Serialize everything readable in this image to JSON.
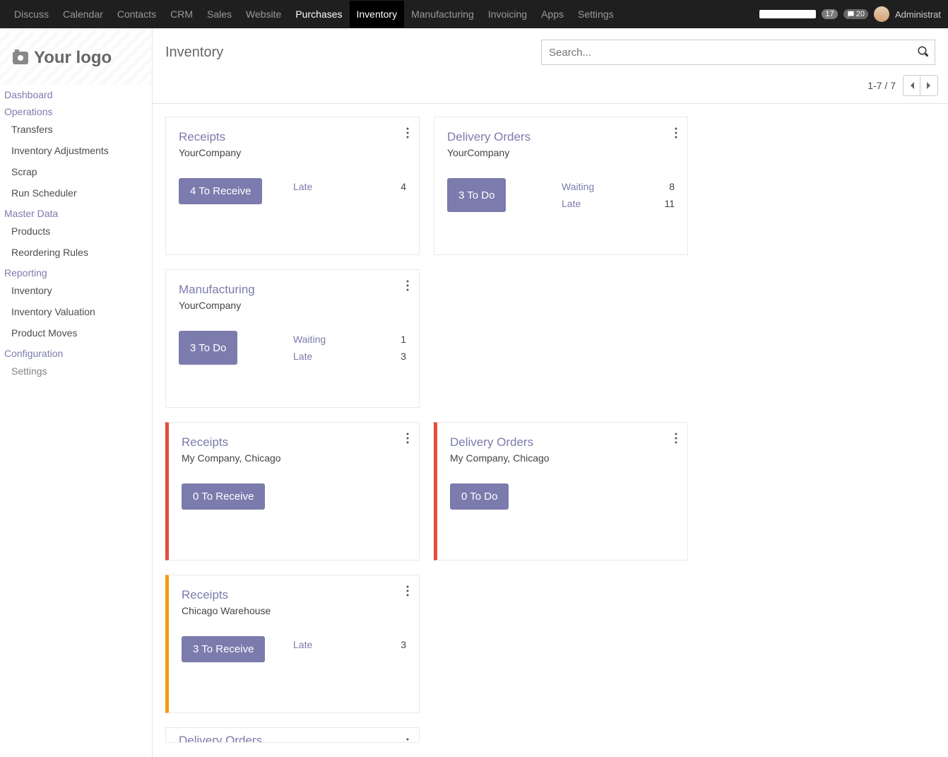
{
  "topnav": {
    "items": [
      {
        "label": "Discuss"
      },
      {
        "label": "Calendar"
      },
      {
        "label": "Contacts"
      },
      {
        "label": "CRM"
      },
      {
        "label": "Sales"
      },
      {
        "label": "Website"
      },
      {
        "label": "Purchases"
      },
      {
        "label": "Inventory"
      },
      {
        "label": "Manufacturing"
      },
      {
        "label": "Invoicing"
      },
      {
        "label": "Apps"
      },
      {
        "label": "Settings"
      }
    ],
    "badge1": "17",
    "badge2": "20",
    "user": "Administrat"
  },
  "logo_text": "Your logo",
  "sidebar": {
    "sections": [
      {
        "title": "Dashboard",
        "items": []
      },
      {
        "title": "Operations",
        "items": [
          "Transfers",
          "Inventory Adjustments",
          "Scrap",
          "Run Scheduler"
        ]
      },
      {
        "title": "Master Data",
        "items": [
          "Products",
          "Reordering Rules"
        ]
      },
      {
        "title": "Reporting",
        "items": [
          "Inventory",
          "Inventory Valuation",
          "Product Moves"
        ]
      },
      {
        "title": "Configuration",
        "items": [
          "Settings"
        ]
      }
    ]
  },
  "page_title": "Inventory",
  "search_placeholder": "Search...",
  "pager_text": "1-7 / 7",
  "cards_row1": [
    {
      "title": "Receipts",
      "sub": "YourCompany",
      "btn": "4 To Receive",
      "stats": [
        {
          "label": "Late",
          "val": "4"
        }
      ]
    },
    {
      "title": "Delivery Orders",
      "sub": "YourCompany",
      "btn": "3 To Do",
      "stats": [
        {
          "label": "Waiting",
          "val": "8"
        },
        {
          "label": "Late",
          "val": "11"
        }
      ]
    },
    {
      "title": "Manufacturing",
      "sub": "YourCompany",
      "btn": "3 To Do",
      "stats": [
        {
          "label": "Waiting",
          "val": "1"
        },
        {
          "label": "Late",
          "val": "3"
        }
      ]
    }
  ],
  "cards_row2": [
    {
      "title": "Receipts",
      "sub": "My Company, Chicago",
      "btn": "0 To Receive",
      "stats": [],
      "stripe": "red"
    },
    {
      "title": "Delivery Orders",
      "sub": "My Company, Chicago",
      "btn": "0 To Do",
      "stats": [],
      "stripe": "red"
    },
    {
      "title": "Receipts",
      "sub": "Chicago Warehouse",
      "btn": "3 To Receive",
      "stats": [
        {
          "label": "Late",
          "val": "3"
        }
      ],
      "stripe": "orange"
    }
  ],
  "cards_row3": [
    {
      "title": "Delivery Orders"
    }
  ]
}
